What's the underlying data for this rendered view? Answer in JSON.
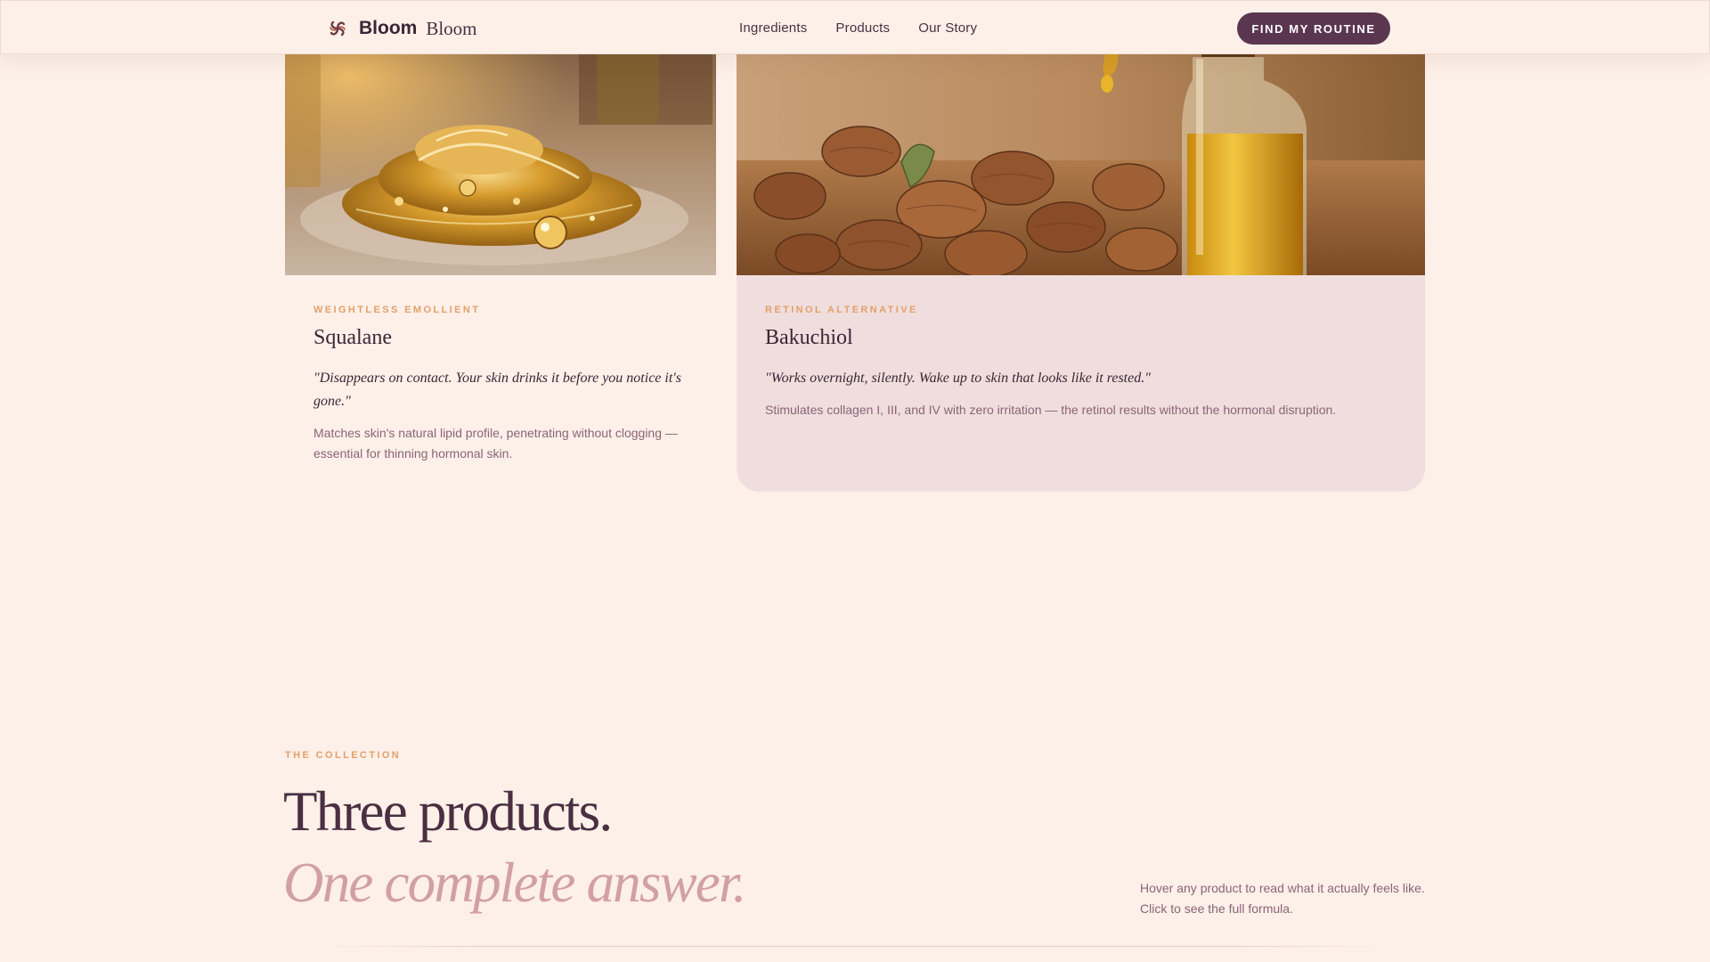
{
  "header": {
    "brand_bold": "Bloom",
    "brand_serif": "Bloom",
    "logo_icon": "swirl-flower-icon",
    "nav": [
      "Ingredients",
      "Products",
      "Our Story"
    ],
    "cta_label": "FIND MY ROUTINE"
  },
  "ingredients": [
    {
      "eyebrow": "WEIGHTLESS EMOLLIENT",
      "name": "Squalane",
      "quote": "\"Disappears on contact. Your skin drinks it before you notice it's gone.\"",
      "description": "Matches skin's natural lipid profile, penetrating without clogging — essential for thinning hormonal skin."
    },
    {
      "eyebrow": "RETINOL ALTERNATIVE",
      "name": "Bakuchiol",
      "quote": "\"Works overnight, silently. Wake up to skin that looks like it rested.\"",
      "description": "Stimulates collagen I, III, and IV with zero irritation — the retinol results without the hormonal disruption."
    }
  ],
  "collection": {
    "eyebrow": "THE COLLECTION",
    "headline": "Three products.",
    "subhead": "One complete answer.",
    "hint_line1": "Hover any product to read what it actually feels like.",
    "hint_line2": "Click to see the full formula."
  },
  "colors": {
    "background": "#fdf0e8",
    "plum": "#5b3650",
    "accent_orange": "#e3a06a",
    "rose": "#d2a0a2",
    "card_pink": "#f0dede"
  }
}
